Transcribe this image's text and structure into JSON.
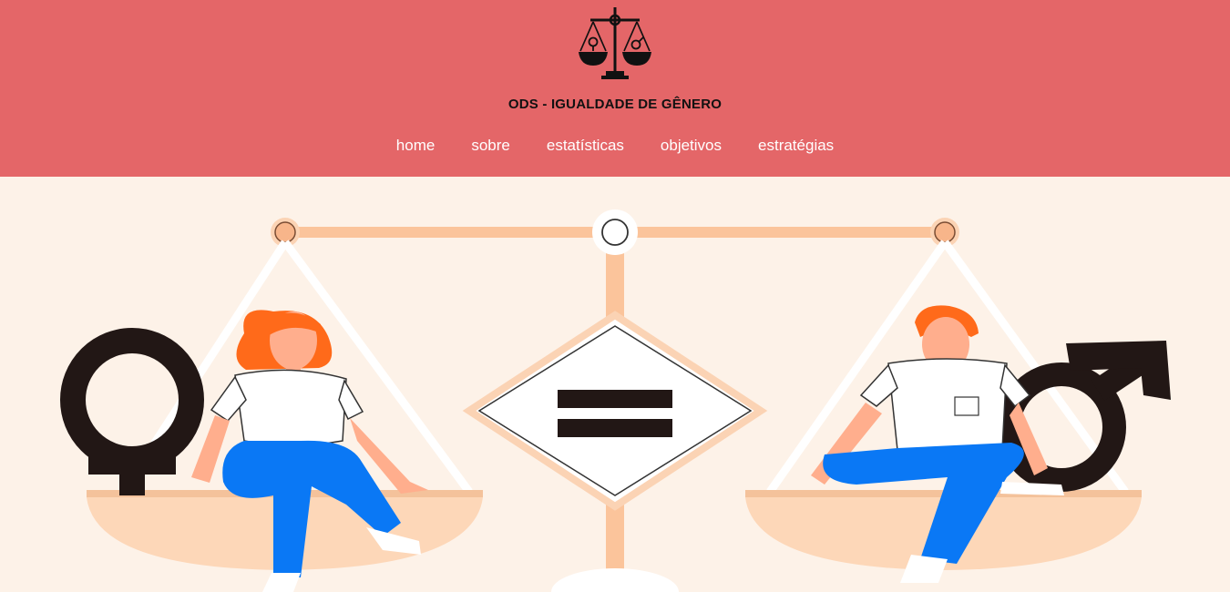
{
  "header": {
    "logo_icon": "scales-of-justice-icon",
    "title": "ODS - IGUALDADE DE GÊNERO",
    "background": "#e46668"
  },
  "nav": {
    "items": [
      {
        "label": "home"
      },
      {
        "label": "sobre"
      },
      {
        "label": "estatísticas"
      },
      {
        "label": "objetivos"
      },
      {
        "label": "estratégias"
      }
    ]
  },
  "hero": {
    "image": "gender-equality-scale-illustration",
    "background": "#fdf2e8",
    "symbols": [
      "female-symbol-icon",
      "equals-icon",
      "male-symbol-icon"
    ]
  }
}
